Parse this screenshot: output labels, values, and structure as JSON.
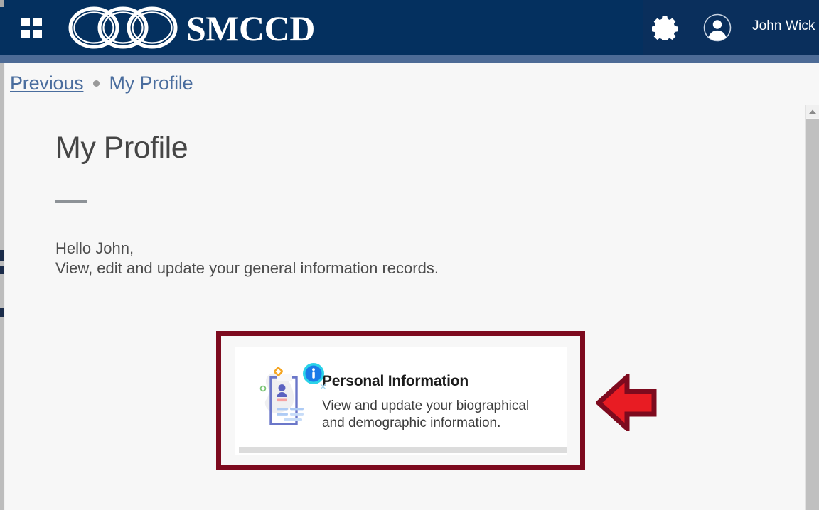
{
  "header": {
    "menu_icon": "waffle-grid-icon",
    "brand_text": "SMCCD",
    "logo_icon": "smccd-three-rings-logo",
    "settings_icon": "gear-icon",
    "avatar_icon": "user-avatar-icon",
    "user_name": "John Wick",
    "bar_color": "#04305f",
    "accent_color": "#4d6b96"
  },
  "breadcrumb": {
    "previous_label": "Previous",
    "separator": "•",
    "current_label": "My Profile"
  },
  "main": {
    "page_title": "My Profile",
    "greeting_line1": "Hello John,",
    "greeting_line2": "View, edit and update your general information records."
  },
  "card": {
    "title": "Personal Information",
    "description": "View and update your biographical and demographic information.",
    "illustration_icon": "document-person-info-illustration",
    "info_badge_icon": "info-circle-icon",
    "highlight_color": "#7d0a1e"
  },
  "annotation": {
    "arrow_icon": "left-pointing-arrow",
    "arrow_fill": "#e81c23",
    "arrow_stroke": "#7d0a1e"
  },
  "scrollbar": {
    "up_arrow_icon": "scroll-up-arrow-icon",
    "thumb_color": "#c0c0c0"
  }
}
